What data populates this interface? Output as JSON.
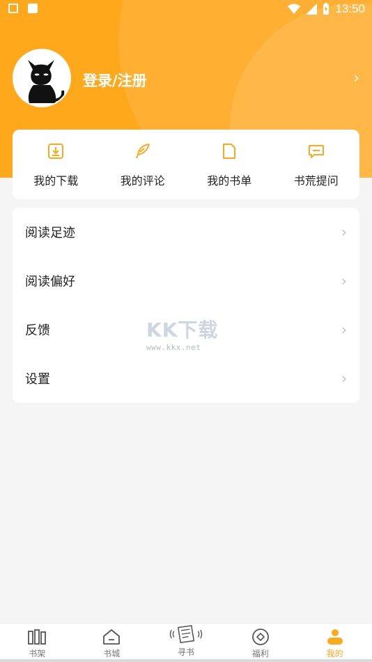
{
  "status_bar": {
    "time": "13:50"
  },
  "profile": {
    "login_label": "登录/注册"
  },
  "quick_actions": [
    {
      "label": "我的下载",
      "icon": "download-icon"
    },
    {
      "label": "我的评论",
      "icon": "feather-icon"
    },
    {
      "label": "我的书单",
      "icon": "document-icon"
    },
    {
      "label": "书荒提问",
      "icon": "chat-icon"
    }
  ],
  "menu": [
    {
      "label": "阅读足迹"
    },
    {
      "label": "阅读偏好"
    },
    {
      "label": "反馈"
    },
    {
      "label": "设置"
    }
  ],
  "watermark": {
    "logo": "KK下载",
    "url": "www.kkx.net"
  },
  "bottom_nav": [
    {
      "label": "书架",
      "icon": "bookshelf-icon"
    },
    {
      "label": "书城",
      "icon": "bookstore-icon"
    },
    {
      "label": "寻书",
      "icon": "find-book-icon"
    },
    {
      "label": "福利",
      "icon": "coin-icon"
    },
    {
      "label": "我的",
      "icon": "profile-icon"
    }
  ],
  "colors": {
    "accent": "#ffa81c",
    "background": "#f5f5f5",
    "chevron": "#bdbdbd"
  }
}
